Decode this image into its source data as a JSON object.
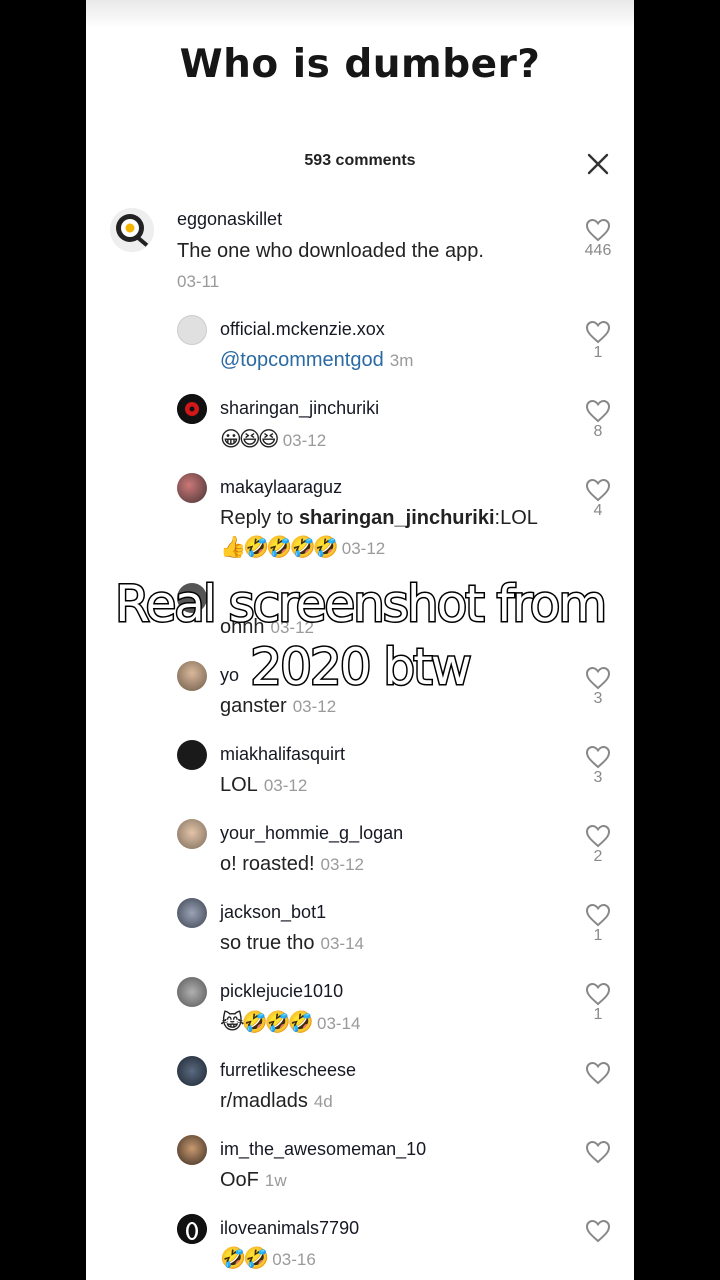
{
  "post_title": "Who is dumber?",
  "comments_count": "593 comments",
  "overlay_caption": [
    "Real screenshot from",
    "2020 btw"
  ],
  "comments": [
    {
      "username": "eggonaskillet",
      "text": "The one who downloaded the app.",
      "time": "03-11",
      "likes": "446",
      "avatar": "egg-on-skillet-icon"
    },
    {
      "username": "official.mckenzie.xox",
      "mention": "@topcommentgod",
      "time": "3m",
      "likes": "1"
    },
    {
      "username": "sharingan_jinchuriki",
      "emoji": "😀😆😆",
      "time": "03-12",
      "likes": "8"
    },
    {
      "username": "makaylaaraguz",
      "reply_prefix": "Reply to ",
      "reply_user": "sharingan_jinchuriki",
      "text": ":LOL",
      "emoji": "👍🤣🤣🤣🤣",
      "time": "03-12",
      "likes": "4"
    },
    {
      "username": "",
      "text": "ohhh",
      "time": "03-12",
      "likes": ""
    },
    {
      "username": "yo",
      "text": "ganster",
      "time": "03-12",
      "likes": "3"
    },
    {
      "username": "miakhalifasquirt",
      "text": "LOL",
      "time": "03-12",
      "likes": "3"
    },
    {
      "username": "your_hommie_g_logan",
      "text": "o! roasted!",
      "time": "03-12",
      "likes": "2"
    },
    {
      "username": "jackson_bot1",
      "text": "so true tho",
      "time": "03-14",
      "likes": "1"
    },
    {
      "username": "picklejucie1010",
      "emoji": "😹🤣🤣🤣",
      "time": "03-14",
      "likes": "1"
    },
    {
      "username": "furretlikescheese",
      "text": "r/madlads",
      "time": "4d",
      "likes": ""
    },
    {
      "username": "im_the_awesomeman_10",
      "text": "OoF",
      "time": "1w",
      "likes": ""
    },
    {
      "username": "iloveanimals7790",
      "emoji": "🤣🤣",
      "time": "03-16",
      "likes": ""
    }
  ]
}
